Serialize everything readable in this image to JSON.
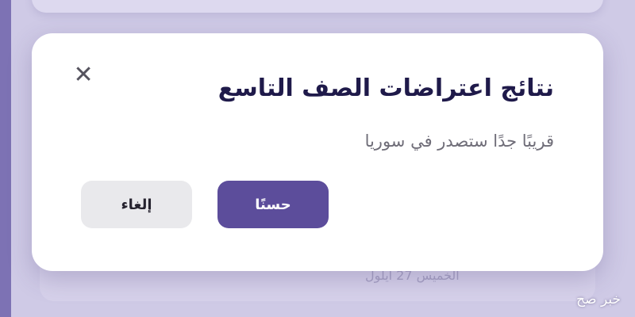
{
  "dialog": {
    "title": "نتائج اعتراضات الصف التاسع",
    "message": "قريبًا جدًا ستصدر في سوريا",
    "ok_label": "حسنًا",
    "cancel_label": "إلغاء",
    "close_icon": "close-icon"
  },
  "background": {
    "date_text": "الخميس 27 أيلول"
  },
  "watermark": {
    "text": "خبر صح"
  },
  "colors": {
    "accent": "#5c4d9b",
    "overlay": "#cfcae6",
    "title": "#1f1a4a"
  }
}
